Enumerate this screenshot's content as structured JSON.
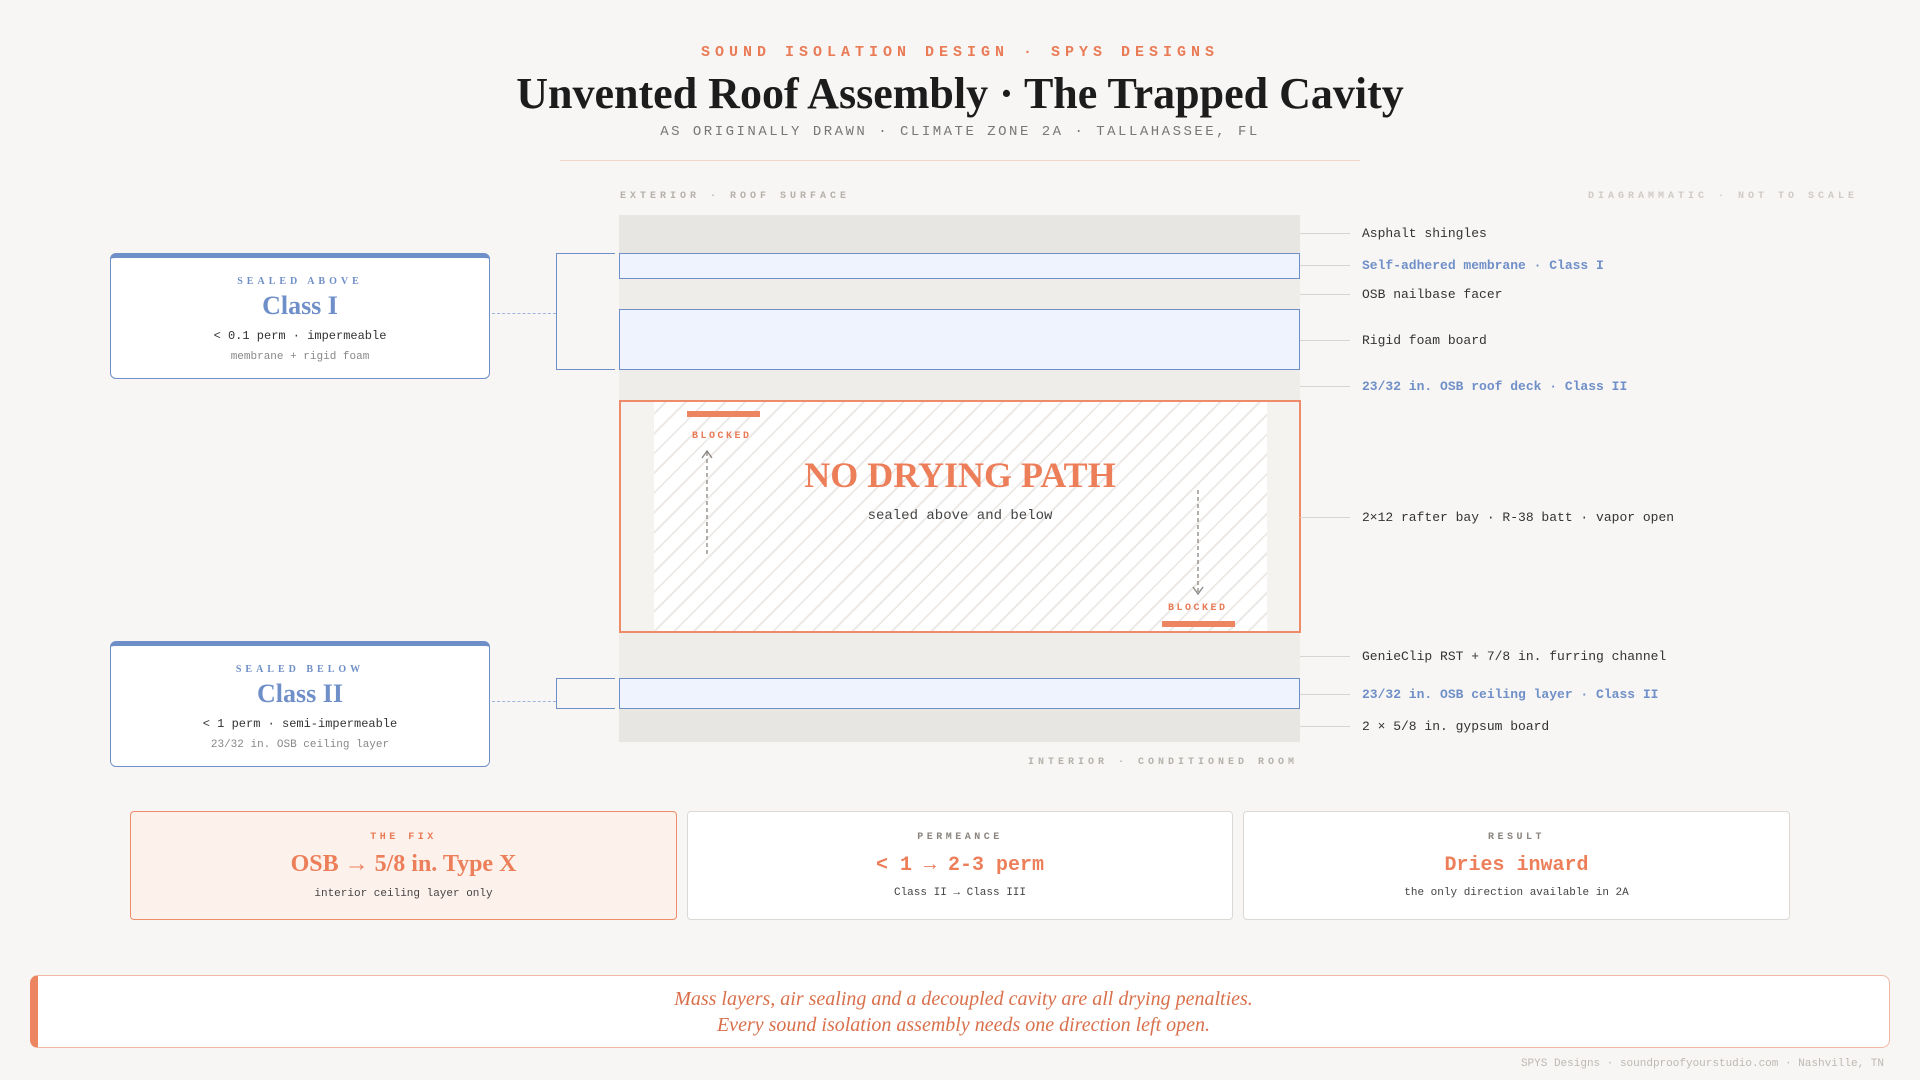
{
  "header": {
    "kicker": "SOUND ISOLATION DESIGN · SPYS DESIGNS",
    "title": "Unvented Roof Assembly · The Trapped Cavity",
    "subtitle": "AS ORIGINALLY DRAWN · CLIMATE ZONE 2A · TALLAHASSEE, FL"
  },
  "diagram": {
    "top_label": "EXTERIOR · ROOF SURFACE",
    "scale_label": "DIAGRAMMATIC · NOT TO SCALE",
    "bottom_label": "INTERIOR · CONDITIONED ROOM",
    "layers": [
      "Asphalt shingles",
      "Self-adhered membrane · Class I",
      "OSB nailbase facer",
      "Rigid foam board",
      "23/32 in. OSB roof deck · Class II",
      "2×12 rafter bay · R-38 batt · vapor open",
      "GenieClip RST + 7/8 in. furring channel",
      "23/32 in. OSB ceiling layer · Class II",
      "2 × 5/8 in. gypsum board"
    ],
    "cavity": {
      "title": "NO DRYING PATH",
      "subtitle": "sealed above and below",
      "blocked_top": "BLOCKED",
      "blocked_bottom": "BLOCKED"
    }
  },
  "cards": {
    "above": {
      "kicker": "SEALED ABOVE",
      "title": "Class I",
      "line": "< 0.1 perm · impermeable",
      "note": "membrane + rigid foam"
    },
    "below": {
      "kicker": "SEALED BELOW",
      "title": "Class II",
      "line": "< 1 perm · semi-impermeable",
      "note": "23/32 in. OSB ceiling layer"
    }
  },
  "stats": [
    {
      "kicker": "THE FIX",
      "value": "OSB → 5/8 in. Type X",
      "sub": "interior ceiling layer only"
    },
    {
      "kicker": "PERMEANCE",
      "value": "< 1 → 2-3 perm",
      "sub": "Class II → Class III"
    },
    {
      "kicker": "RESULT",
      "value": "Dries inward",
      "sub": "the only direction available in 2A"
    }
  ],
  "quote": {
    "line1": "Mass layers, air sealing and a decoupled cavity are all drying penalties.",
    "line2": "Every sound isolation assembly needs one direction left open."
  },
  "footer": "SPYS Designs · soundproofyourstudio.com · Nashville, TN",
  "colors": {
    "accent_orange": "#ec7f5a",
    "class_blue": "#6f8fc8",
    "background": "#f8f6f4"
  }
}
